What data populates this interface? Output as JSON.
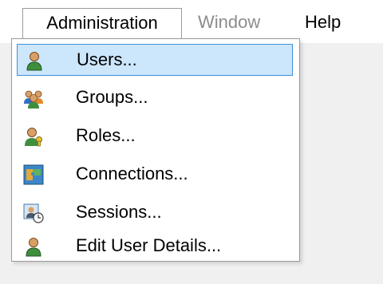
{
  "menubar": {
    "items": [
      {
        "label": "Administration",
        "state": "open"
      },
      {
        "label": "Window",
        "state": "disabled"
      },
      {
        "label": "Help",
        "state": "normal"
      }
    ]
  },
  "dropdown": {
    "items": [
      {
        "label": "Users...",
        "icon": "user-icon",
        "highlighted": true
      },
      {
        "label": "Groups...",
        "icon": "group-icon"
      },
      {
        "label": "Roles...",
        "icon": "role-icon"
      },
      {
        "label": "Connections...",
        "icon": "connections-icon"
      },
      {
        "label": "Sessions...",
        "icon": "sessions-icon"
      },
      {
        "label": "Edit User Details...",
        "icon": "edit-user-icon"
      }
    ]
  },
  "colors": {
    "highlight_fill": "#cce6fb",
    "highlight_border": "#3f8fd6",
    "disabled_text": "#8c8c8c"
  }
}
